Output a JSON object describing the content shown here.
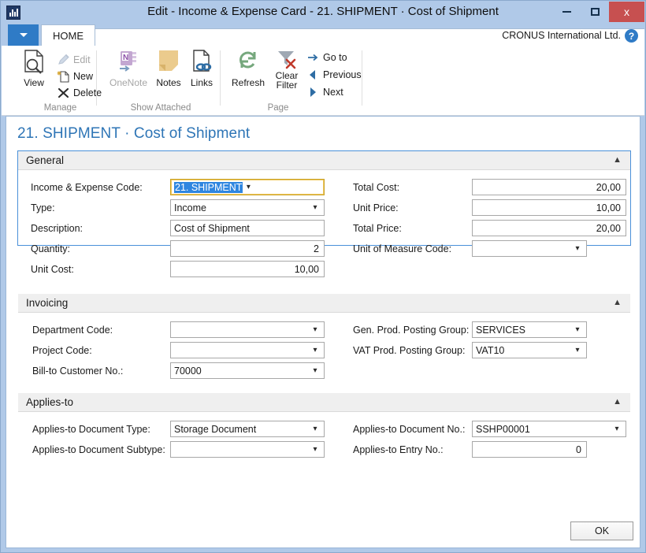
{
  "window": {
    "title": "Edit - Income & Expense Card - 21. SHIPMENT · Cost of Shipment",
    "app_icon": "chart-bars-icon",
    "minimize_label": "Minimize",
    "maximize_label": "Maximize",
    "close_label": "x"
  },
  "ribbon": {
    "quick_access_label": "",
    "tab_home": "HOME",
    "company": "CRONUS International Ltd.",
    "help_label": "?",
    "groups": [
      {
        "name": "Manage",
        "label": "Manage",
        "big": [
          {
            "label": "View",
            "icon": "page-search-icon"
          }
        ],
        "small": [
          {
            "label": "Edit",
            "icon": "pencil-icon",
            "disabled": true
          },
          {
            "label": "New",
            "icon": "new-page-icon",
            "disabled": false
          },
          {
            "label": "Delete",
            "icon": "x-delete-icon",
            "disabled": false
          }
        ]
      },
      {
        "name": "Show Attached",
        "label": "Show Attached",
        "big": [
          {
            "label": "OneNote",
            "icon": "onenote-icon",
            "disabled": true
          },
          {
            "label": "Notes",
            "icon": "sticky-note-icon",
            "disabled": false
          },
          {
            "label": "Links",
            "icon": "page-link-icon",
            "disabled": false
          }
        ],
        "small": []
      },
      {
        "name": "Page",
        "label": "Page",
        "big": [
          {
            "label": "Refresh",
            "icon": "refresh-icon"
          },
          {
            "label": "Clear Filter",
            "icon": "clear-filter-icon"
          }
        ],
        "small": [
          {
            "label": "Go to",
            "icon": "arrow-right-icon"
          },
          {
            "label": "Previous",
            "icon": "arrow-left-icon"
          },
          {
            "label": "Next",
            "icon": "arrow-right-filled-icon"
          }
        ]
      }
    ]
  },
  "page": {
    "title": "21. SHIPMENT · Cost of Shipment"
  },
  "sections": {
    "general": {
      "header": "General",
      "chevron": "collapse-chevron",
      "fields": {
        "income_expense_code": {
          "label": "Income & Expense Code:",
          "value": "21. SHIPMENT"
        },
        "type": {
          "label": "Type:",
          "value": "Income"
        },
        "description": {
          "label": "Description:",
          "value": "Cost of Shipment"
        },
        "quantity": {
          "label": "Quantity:",
          "value": "2"
        },
        "unit_cost": {
          "label": "Unit Cost:",
          "value": "10,00"
        },
        "total_cost": {
          "label": "Total Cost:",
          "value": "20,00"
        },
        "unit_price": {
          "label": "Unit Price:",
          "value": "10,00"
        },
        "total_price": {
          "label": "Total Price:",
          "value": "20,00"
        },
        "unit_of_measure": {
          "label": "Unit of Measure Code:",
          "value": ""
        }
      }
    },
    "invoicing": {
      "header": "Invoicing",
      "chevron": "collapse-chevron",
      "fields": {
        "department_code": {
          "label": "Department Code:",
          "value": ""
        },
        "project_code": {
          "label": "Project Code:",
          "value": ""
        },
        "bill_to_customer_no": {
          "label": "Bill-to Customer No.:",
          "value": "70000"
        },
        "gen_prod_posting": {
          "label": "Gen. Prod. Posting Group:",
          "value": "SERVICES"
        },
        "vat_prod_posting": {
          "label": "VAT Prod. Posting Group:",
          "value": "VAT10"
        }
      }
    },
    "applies_to": {
      "header": "Applies-to",
      "chevron": "collapse-chevron",
      "fields": {
        "document_type": {
          "label": "Applies-to Document Type:",
          "value": "Storage Document"
        },
        "document_subtype": {
          "label": "Applies-to Document Subtype:",
          "value": ""
        },
        "document_no": {
          "label": "Applies-to Document No.:",
          "value": "SSHP00001"
        },
        "entry_no": {
          "label": "Applies-to Entry No.:",
          "value": "0"
        }
      }
    }
  },
  "footer": {
    "ok_label": "OK"
  },
  "colors": {
    "title_bar": "#b0c9e8",
    "close_button": "#c75050",
    "accent_blue": "#2f7bc6",
    "page_title": "#2e75b6",
    "focus_border": "#4a90d9",
    "selection": "#2f86e0",
    "section_header_bg": "#efefef"
  }
}
